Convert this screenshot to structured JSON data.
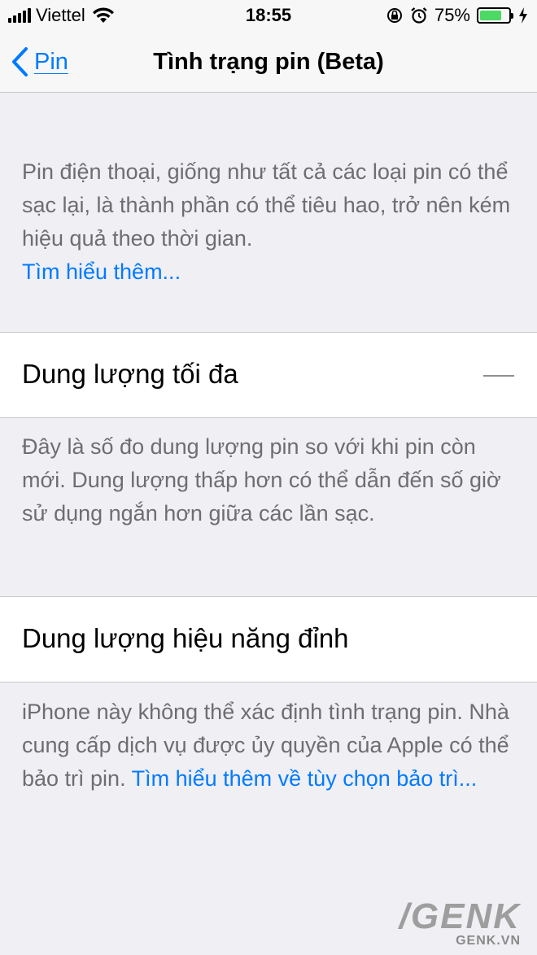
{
  "status_bar": {
    "carrier": "Viettel",
    "time": "18:55",
    "battery_percent": "75%",
    "battery_level": 0.75,
    "icons": [
      "signal-icon",
      "wifi-icon",
      "orientation-lock-icon",
      "alarm-icon",
      "battery-icon",
      "charging-bolt-icon"
    ]
  },
  "nav": {
    "back_label": "Pin",
    "title": "Tình trạng pin (Beta)"
  },
  "intro": {
    "text": "Pin điện thoại, giống như tất cả các loại pin có thể sạc lại, là thành phần có thể tiêu hao, trở nên kém hiệu quả theo thời gian.",
    "link": "Tìm hiểu thêm..."
  },
  "max_capacity": {
    "label": "Dung lượng tối đa",
    "value": "—",
    "footer": "Đây là số đo dung lượng pin so với khi pin còn mới. Dung lượng thấp hơn có thể dẫn đến số giờ sử dụng ngắn hơn giữa các lần sạc."
  },
  "peak_performance": {
    "label": "Dung lượng hiệu năng đỉnh",
    "footer_text": "iPhone này không thể xác định tình trạng pin. Nhà cung cấp dịch vụ được ủy quyền của Apple có thể bảo trì pin.",
    "footer_link": "Tìm hiểu thêm về tùy chọn bảo trì..."
  },
  "watermark": {
    "logo": "/GENK",
    "url": "GENK.VN"
  }
}
